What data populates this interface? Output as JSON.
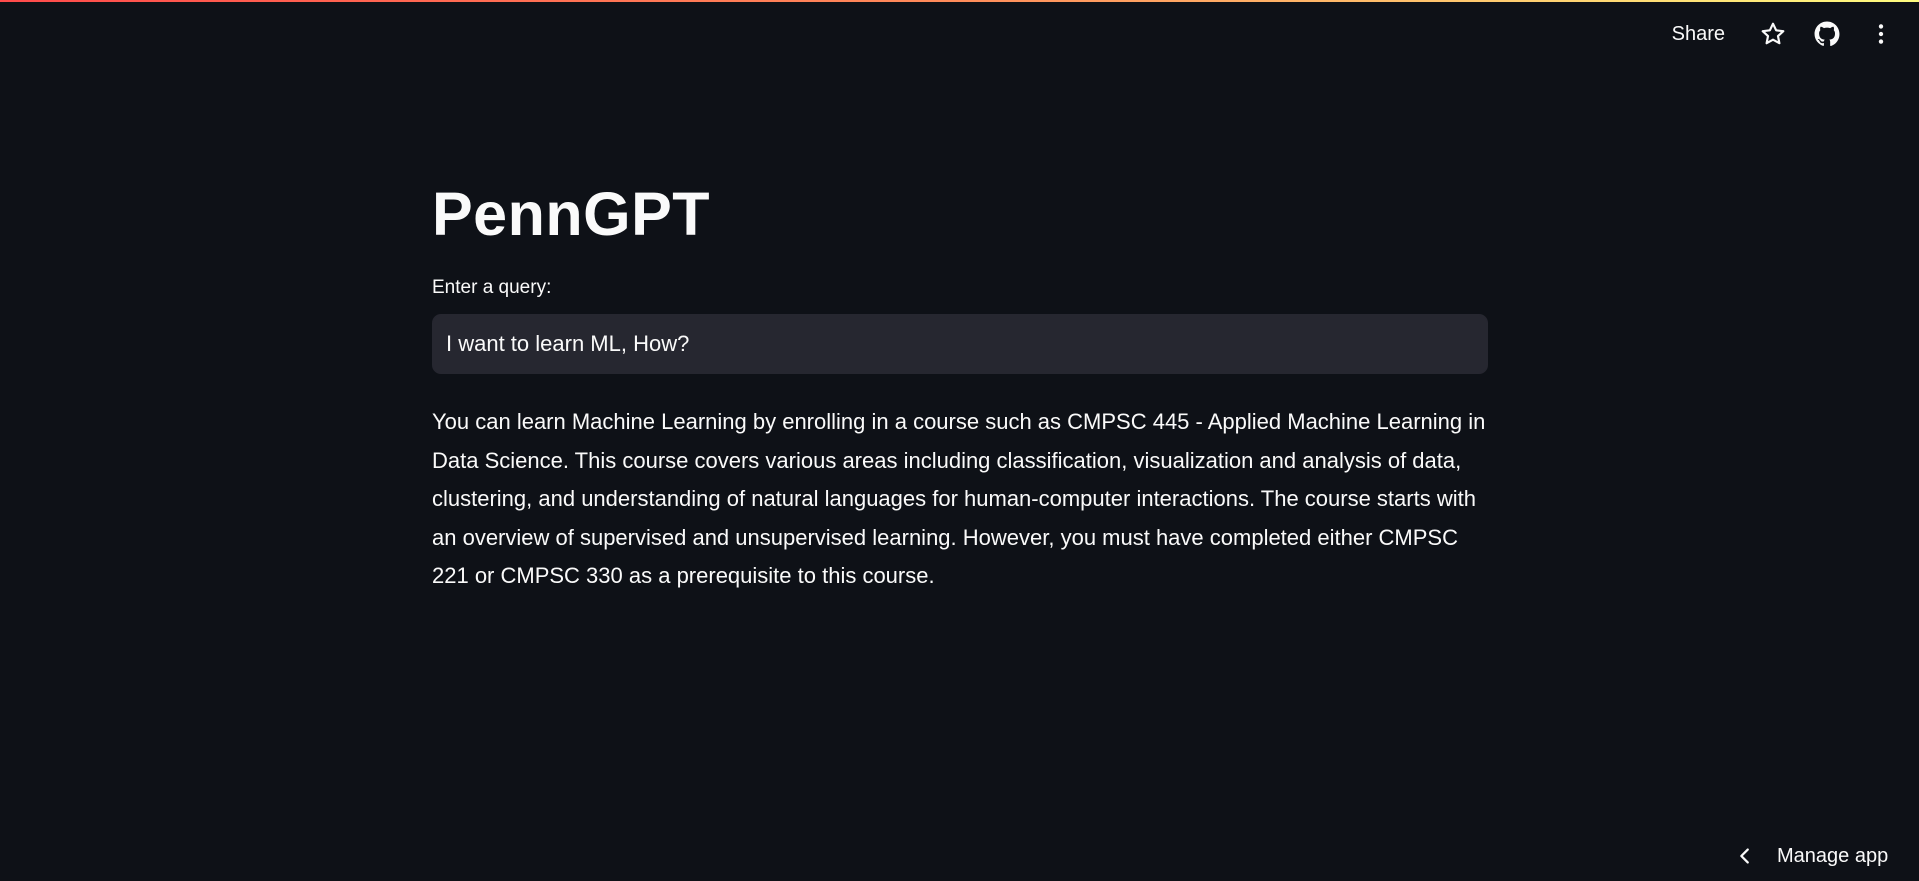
{
  "header": {
    "share_label": "Share",
    "icons": [
      "star-icon",
      "github-icon",
      "more-vertical-icon"
    ]
  },
  "main": {
    "title": "PennGPT",
    "query_label": "Enter a query:",
    "query_value": "I want to learn ML, How?",
    "answer": "You can learn Machine Learning by enrolling in a course such as CMPSC 445 - Applied Machine Learning in Data Science. This course covers various areas including classification, visualization and analysis of data, clustering, and understanding of natural languages for human-computer interactions. The course starts with an overview of supervised and unsupervised learning. However, you must have completed either CMPSC 221 or CMPSC 330 as a prerequisite to this course."
  },
  "footer": {
    "manage_app_label": "Manage app",
    "icon": "chevron-left-icon"
  },
  "colors": {
    "background": "#0e1117",
    "input_background": "#262730",
    "text": "#fafafa",
    "accent_gradient": [
      "#ff4b4b",
      "#fffd80"
    ]
  }
}
